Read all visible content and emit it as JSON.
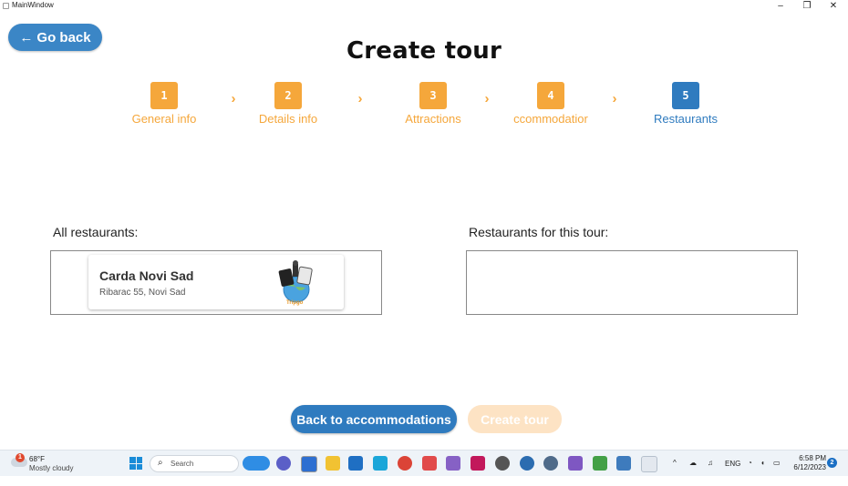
{
  "window": {
    "title": "MainWindow",
    "minimize": "–",
    "maximize": "❐",
    "close": "✕"
  },
  "header": {
    "back_label": "Go back",
    "back_arrow": "←",
    "title": "Create tour"
  },
  "steps": [
    {
      "num": "1",
      "label": "General info",
      "state": "done"
    },
    {
      "num": "2",
      "label": "Details info",
      "state": "done"
    },
    {
      "num": "3",
      "label": "Attractions",
      "state": "done"
    },
    {
      "num": "4",
      "label": "ccommodatior",
      "state": "done"
    },
    {
      "num": "5",
      "label": "Restaurants",
      "state": "current"
    }
  ],
  "step_separator": "›",
  "all_restaurants": {
    "label": "All restaurants:",
    "items": [
      {
        "name": "Carda Novi Sad",
        "address": "Ribarac 55, Novi Sad",
        "logo_text": "Tripgo"
      }
    ]
  },
  "tour_restaurants": {
    "label": "Restaurants for this tour:",
    "items": []
  },
  "footer": {
    "back_button": "Back to accommodations",
    "create_button": "Create tour"
  },
  "taskbar": {
    "weather_temp": "68°F",
    "weather_cond": "Mostly cloudy",
    "weather_badge": "1",
    "search_placeholder": "Search",
    "lang": "ENG",
    "time": "6:58 PM",
    "date": "6/12/2023",
    "notif_count": "2",
    "tray_chevron": "^"
  },
  "colors": {
    "orange": "#f5a73b",
    "blue": "#2f7bbf",
    "disabled": "#fde3c4"
  }
}
